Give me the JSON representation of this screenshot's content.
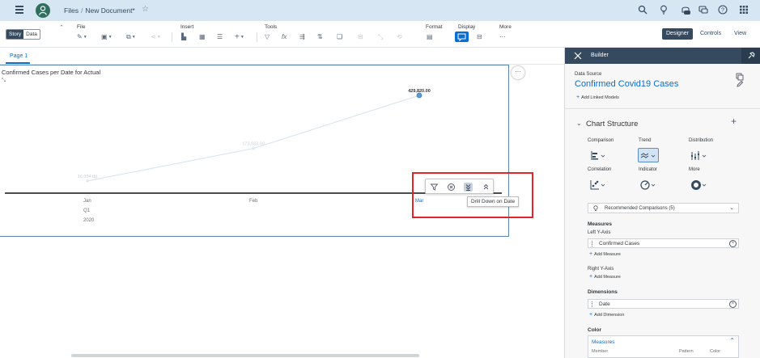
{
  "shell": {
    "breadcrumb_root": "Files",
    "breadcrumb_sep": "/",
    "document_name": "New Document*"
  },
  "toolbar": {
    "story_label": "Story",
    "data_label": "Data",
    "groups": {
      "file": "File",
      "insert": "Insert",
      "tools": "Tools",
      "format": "Format",
      "display": "Display",
      "more": "More"
    },
    "more_dots": "···",
    "modes": [
      "Designer",
      "Controls",
      "View"
    ]
  },
  "canvas": {
    "page_tab": "Page 1"
  },
  "chart_data": {
    "type": "line",
    "title": "Confirmed Cases per Date for Actual",
    "categories": [
      "Jan",
      "Feb",
      "Mar"
    ],
    "category_sublabels": [
      "Q1",
      "2020"
    ],
    "series": [
      {
        "name": "Confirmed Cases",
        "values": [
          16054,
          173033,
          429820
        ]
      }
    ],
    "data_labels": [
      "16,054.00",
      "173,033.00",
      "429,820.00"
    ],
    "highlighted_point": 2,
    "legend": "none",
    "grid": false
  },
  "popup": {
    "tooltip": "Drill Down on Date"
  },
  "builder": {
    "header": "Builder",
    "data_source_label": "Data Source",
    "data_source_name": "Confirmed Covid19 Cases",
    "add_linked_models": "Add Linked Models",
    "chart_structure": "Chart Structure",
    "chart_types": [
      {
        "label": "Comparison",
        "icon": "bar-chart-icon"
      },
      {
        "label": "Trend",
        "icon": "trend-line-icon"
      },
      {
        "label": "Distribution",
        "icon": "distribution-icon"
      },
      {
        "label": "Correlation",
        "icon": "scatter-icon"
      },
      {
        "label": "Indicator",
        "icon": "gauge-icon"
      },
      {
        "label": "More",
        "icon": "donut-icon"
      }
    ],
    "recommended": "Recommended Comparisons (5)",
    "measures_heading": "Measures",
    "left_axis": "Left Y-Axis",
    "left_measure": "Confirmed Cases",
    "add_measure": "Add Measure",
    "right_axis": "Right Y-Axis",
    "dimensions_heading": "Dimensions",
    "dimension": "Date",
    "add_dimension": "Add Dimension",
    "color_heading": "Color",
    "color_box_title": "Measures",
    "color_cols": [
      "Member",
      "Pattern",
      "Color"
    ]
  },
  "colors": {
    "shell_bg": "#d6e6f3",
    "accent": "#0a6ed1",
    "builder_header": "#354a5f",
    "highlight_box": "#e3242b"
  }
}
